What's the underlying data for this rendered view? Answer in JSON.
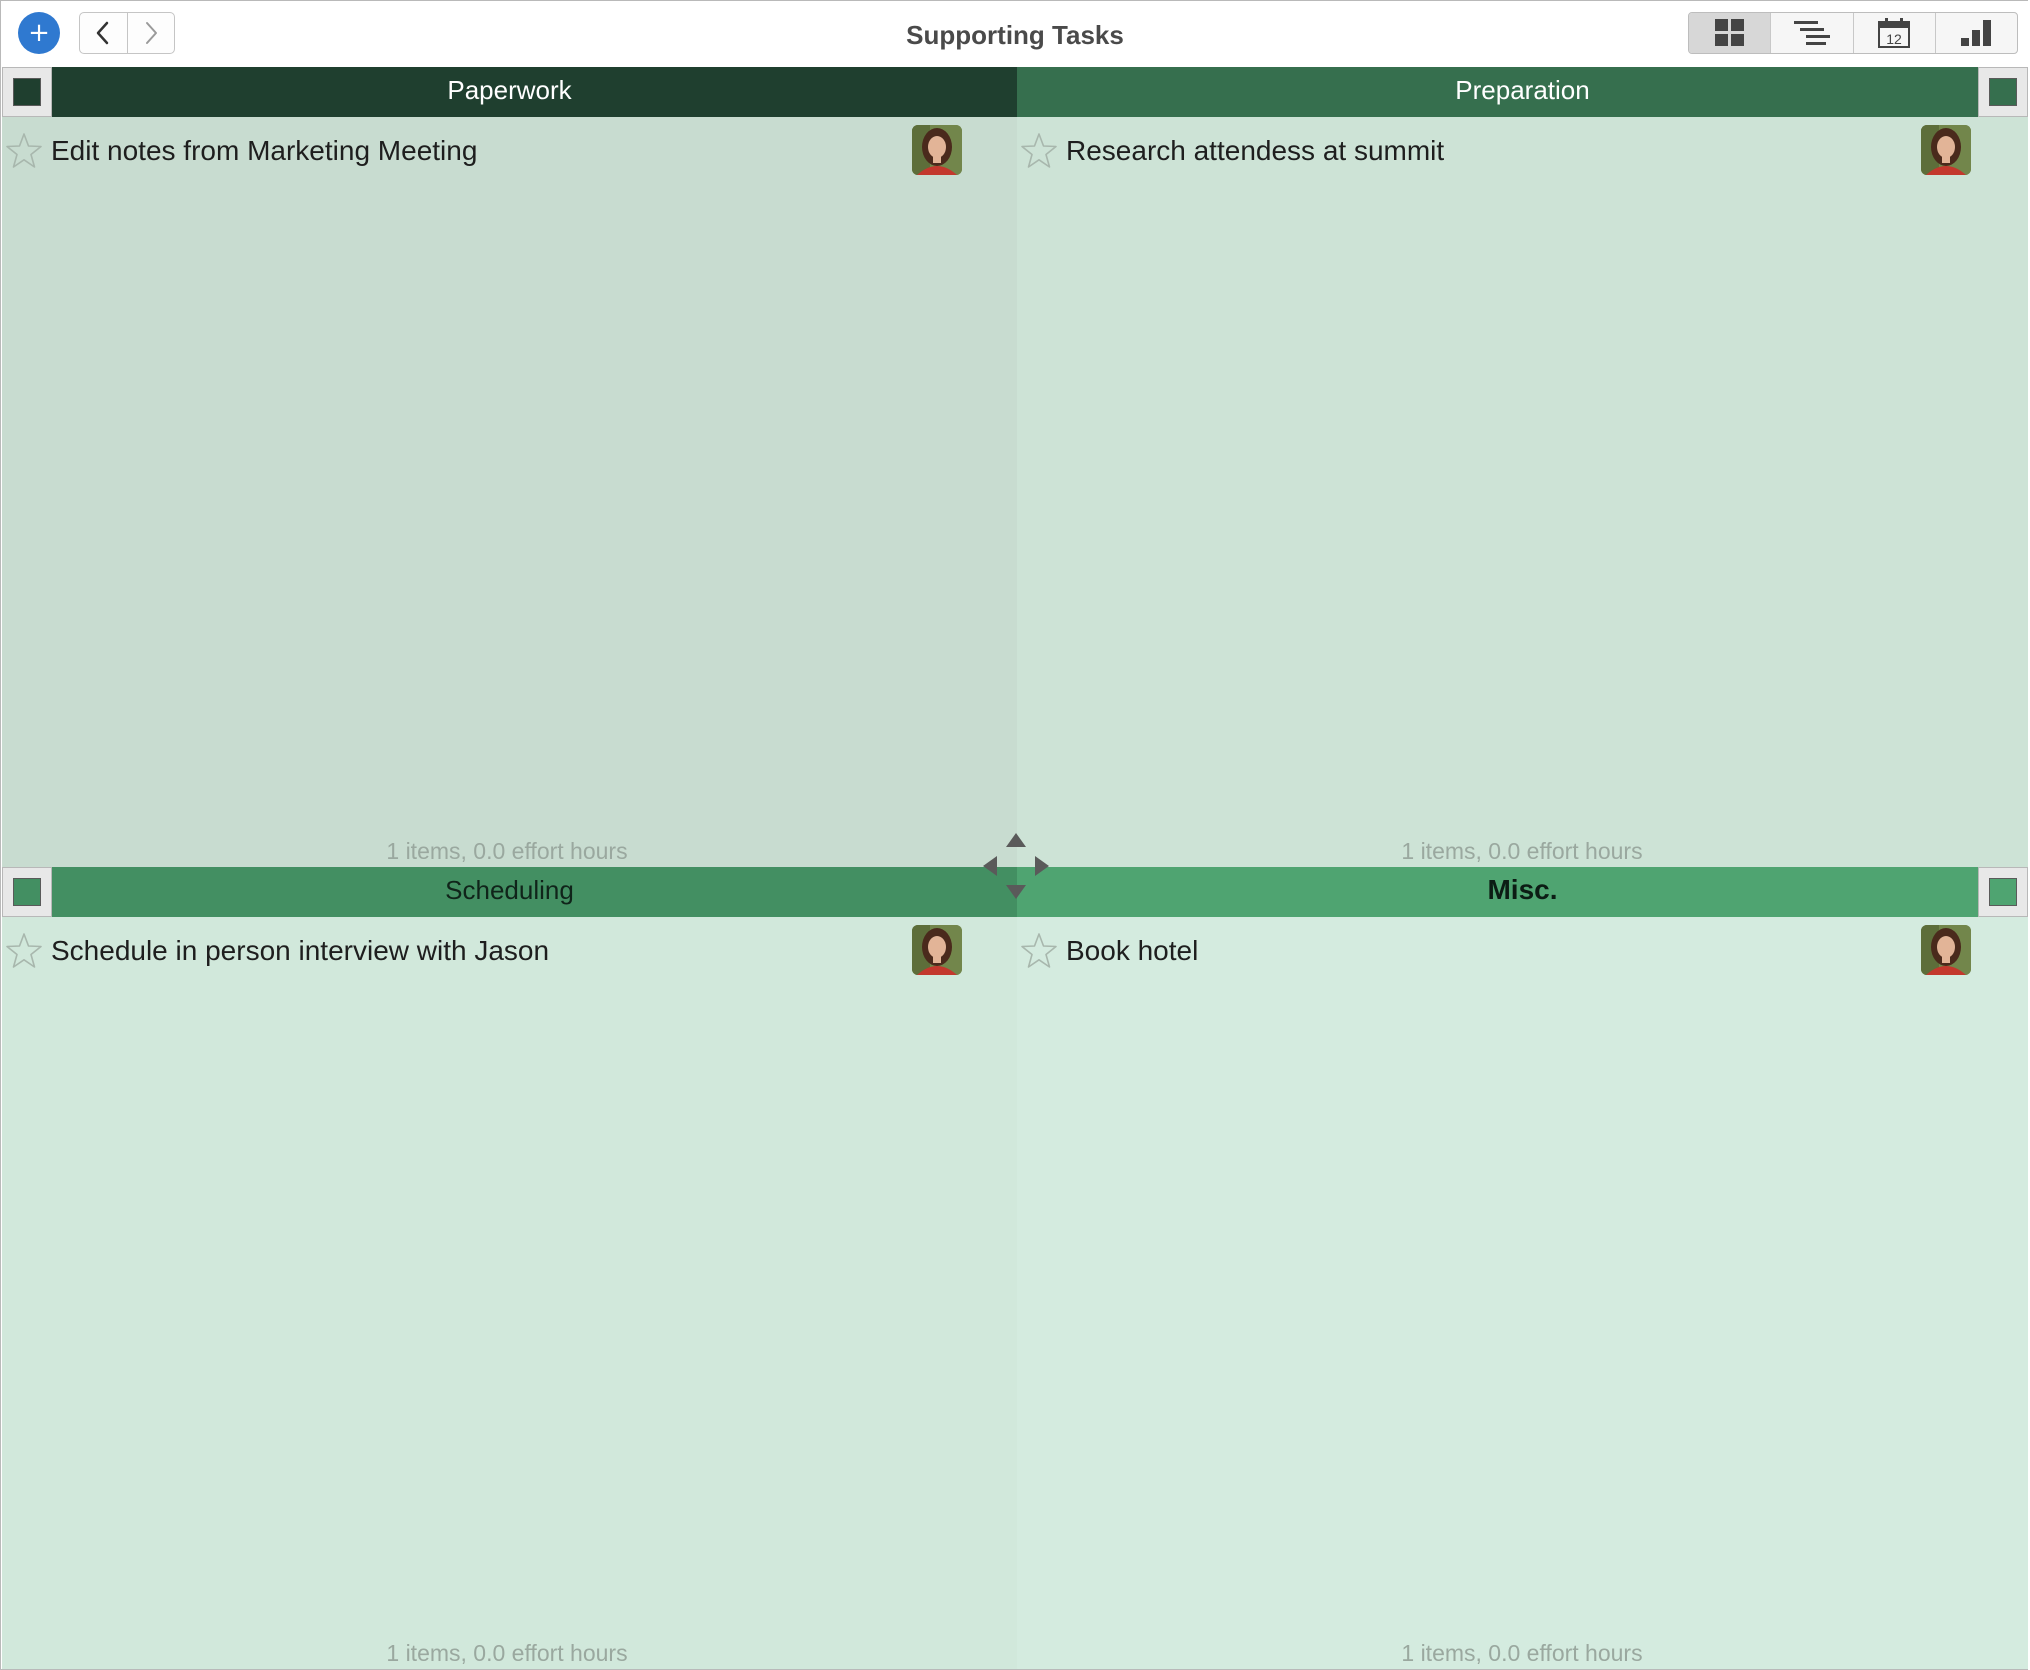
{
  "window": {
    "title": "Supporting Tasks"
  },
  "toolbar": {
    "add_label": "+",
    "back_icon": "chevron-left-icon",
    "forward_icon": "chevron-right-icon",
    "views": [
      {
        "name": "grid-view-icon",
        "active": true
      },
      {
        "name": "outline-view-icon",
        "active": false
      },
      {
        "name": "calendar-view-icon",
        "label": "12",
        "active": false
      },
      {
        "name": "chart-view-icon",
        "active": false
      }
    ]
  },
  "quadrants": [
    {
      "name": "Paperwork",
      "color": "#1f3f2f",
      "tasks": [
        {
          "title": "Edit notes from Marketing Meeting",
          "starred": false
        }
      ],
      "footer": "1 items, 0.0 effort hours"
    },
    {
      "name": "Preparation",
      "color": "#366f4e",
      "tasks": [
        {
          "title": "Research attendess at summit",
          "starred": false
        }
      ],
      "footer": "1 items, 0.0 effort hours"
    },
    {
      "name": "Scheduling",
      "color": "#438f62",
      "tasks": [
        {
          "title": "Schedule in person interview with Jason",
          "starred": false
        }
      ],
      "footer": "1 items, 0.0 effort hours"
    },
    {
      "name": "Misc.",
      "color": "#4fa471",
      "tasks": [
        {
          "title": "Book hotel",
          "starred": false
        }
      ],
      "footer": "1 items, 0.0 effort hours"
    }
  ]
}
